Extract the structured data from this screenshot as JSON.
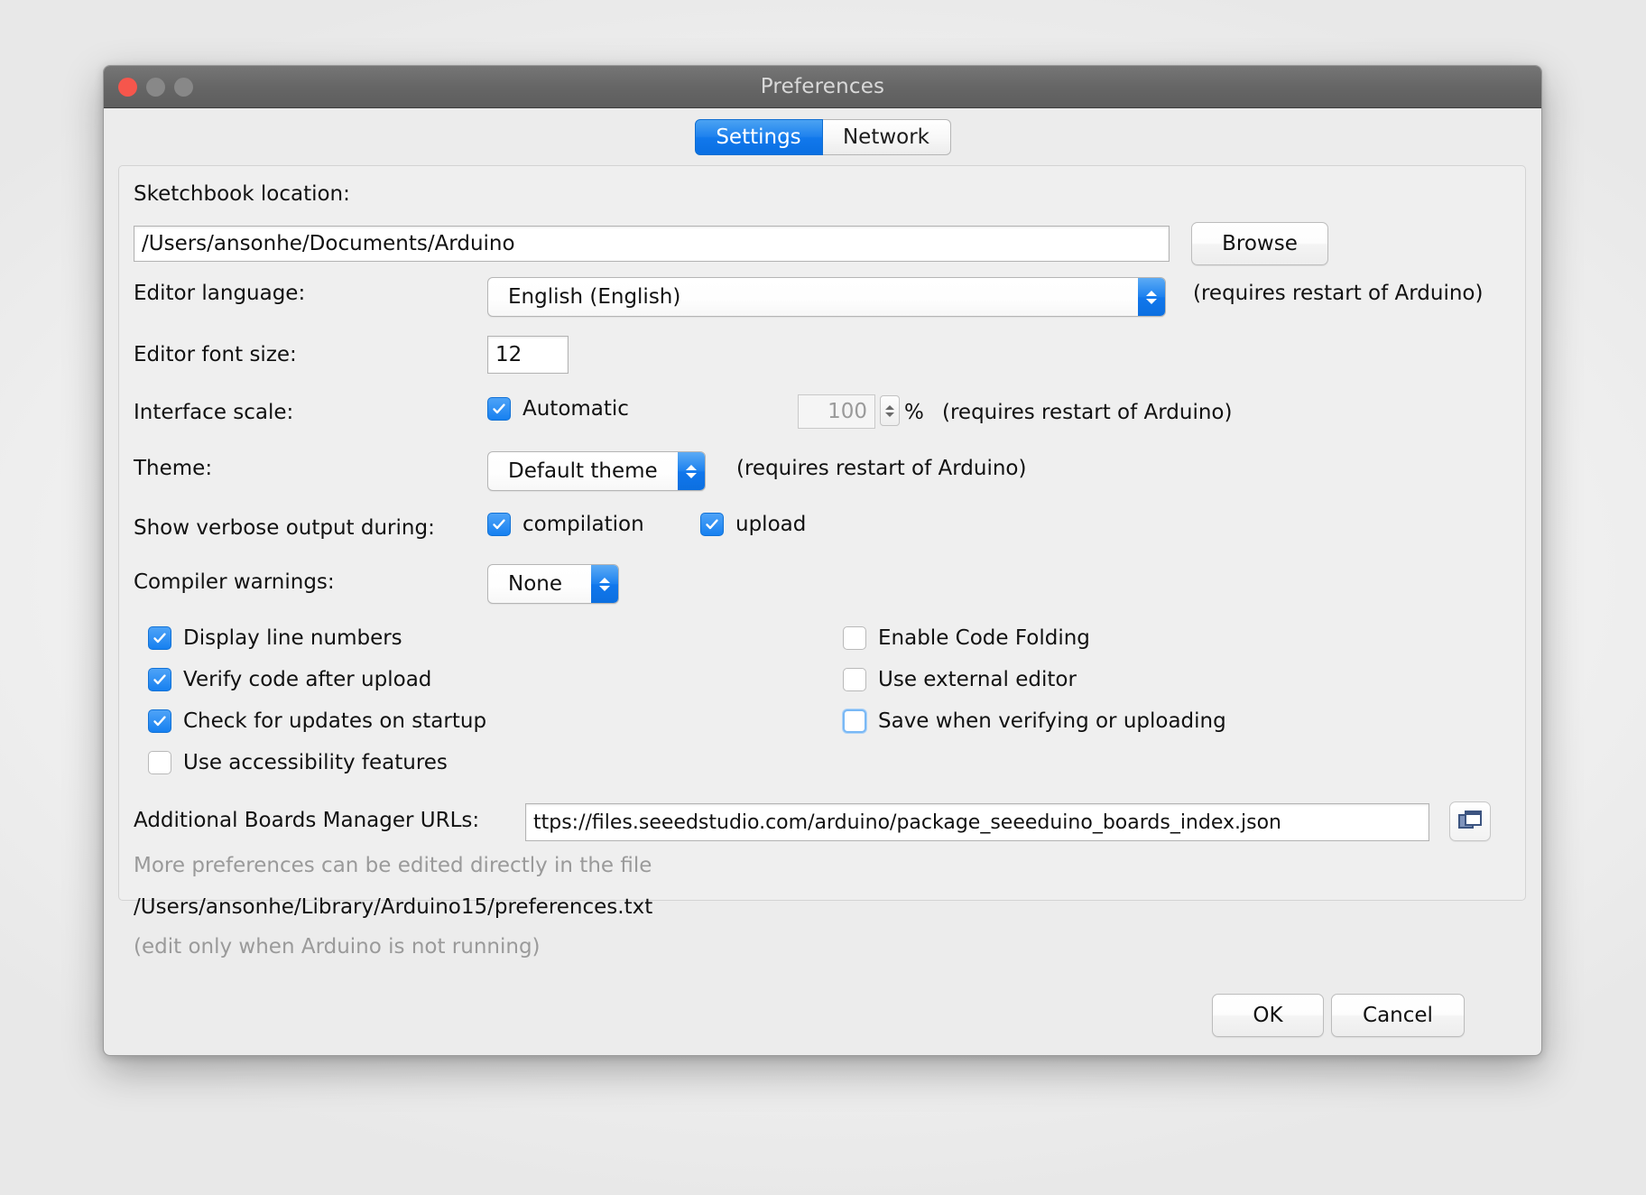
{
  "window": {
    "title": "Preferences",
    "traffic_lights": [
      "close",
      "minimize",
      "zoom"
    ]
  },
  "tabs": [
    {
      "label": "Settings",
      "active": true
    },
    {
      "label": "Network",
      "active": false
    }
  ],
  "settings": {
    "sketchbook": {
      "label": "Sketchbook location:",
      "value": "/Users/ansonhe/Documents/Arduino",
      "browse_label": "Browse"
    },
    "editor_language": {
      "label": "Editor language:",
      "value": "English (English)",
      "note": "(requires restart of Arduino)"
    },
    "editor_font_size": {
      "label": "Editor font size:",
      "value": "12"
    },
    "interface_scale": {
      "label": "Interface scale:",
      "automatic_label": "Automatic",
      "automatic_checked": true,
      "percent_value": "100",
      "percent_symbol": "%",
      "note": "(requires restart of Arduino)"
    },
    "theme": {
      "label": "Theme:",
      "value": "Default theme",
      "note": "(requires restart of Arduino)"
    },
    "verbose_output": {
      "label": "Show verbose output during:",
      "options": [
        {
          "label": "compilation",
          "checked": true
        },
        {
          "label": "upload",
          "checked": true
        }
      ]
    },
    "compiler_warnings": {
      "label": "Compiler warnings:",
      "value": "None"
    },
    "checkbox_column_left": [
      {
        "label": "Display line numbers",
        "checked": true,
        "focused": false
      },
      {
        "label": "Verify code after upload",
        "checked": true,
        "focused": false
      },
      {
        "label": "Check for updates on startup",
        "checked": true,
        "focused": false
      },
      {
        "label": "Use accessibility features",
        "checked": false,
        "focused": false
      }
    ],
    "checkbox_column_right": [
      {
        "label": "Enable Code Folding",
        "checked": false,
        "focused": false
      },
      {
        "label": "Use external editor",
        "checked": false,
        "focused": false
      },
      {
        "label": "Save when verifying or uploading",
        "checked": false,
        "focused": true
      }
    ],
    "boards_manager": {
      "label": "Additional Boards Manager URLs:",
      "value": "ttps://files.seeedstudio.com/arduino/package_seeeduino_boards_index.json",
      "icon_name": "open-urls-window-icon"
    },
    "footnote": {
      "line1": "More preferences can be edited directly in the file",
      "line2": "/Users/ansonhe/Library/Arduino15/preferences.txt",
      "line3": "(edit only when Arduino is not running)"
    }
  },
  "footer": {
    "ok_label": "OK",
    "cancel_label": "Cancel"
  },
  "colors": {
    "accent_blue": "#1680f0",
    "tab_active_blue": "#1178ec",
    "window_chrome": "#666666",
    "panel_bg": "#efefef",
    "muted_text": "#9a9a9a"
  }
}
